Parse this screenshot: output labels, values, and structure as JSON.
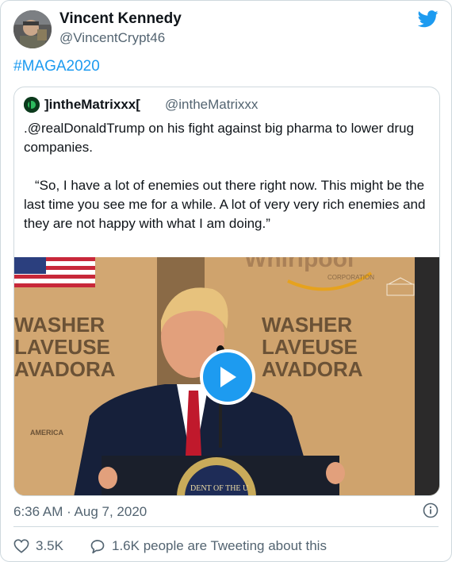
{
  "author": {
    "name": "Vincent Kennedy",
    "handle": "@VincentCrypt46"
  },
  "hashtag": "#MAGA2020",
  "quoted_tweet": {
    "name": "]intheMatrixxx[",
    "handle": "@intheMatrixxx",
    "text_line1": ".@realDonaldTrump on his fight against big pharma to lower drug companies.",
    "text_line2": "“So, I have a lot of enemies out there right now. This might be the last time you see me for a while. A lot of very very rich enemies and they are not happy with what I am doing.”",
    "media": {
      "sign_left": [
        "WASHER",
        "LAVEUSE",
        "AVADORA"
      ],
      "sign_right": [
        "WASHER",
        "LAVEUSE",
        "AVADORA"
      ],
      "brand_text": "Whirlpool",
      "corp_text": "CORPORATION",
      "america_text": "AMERICA",
      "seal_text": "DENT OF THE U"
    }
  },
  "timestamp": "6:36 AM · Aug 7, 2020",
  "actions": {
    "like_count": "3.5K",
    "reply_text": "1.6K people are Tweeting about this"
  },
  "colors": {
    "twitter_blue": "#1d9bf0",
    "like_icon": "heart-outline-icon",
    "reply_icon": "speech-bubble-icon"
  }
}
